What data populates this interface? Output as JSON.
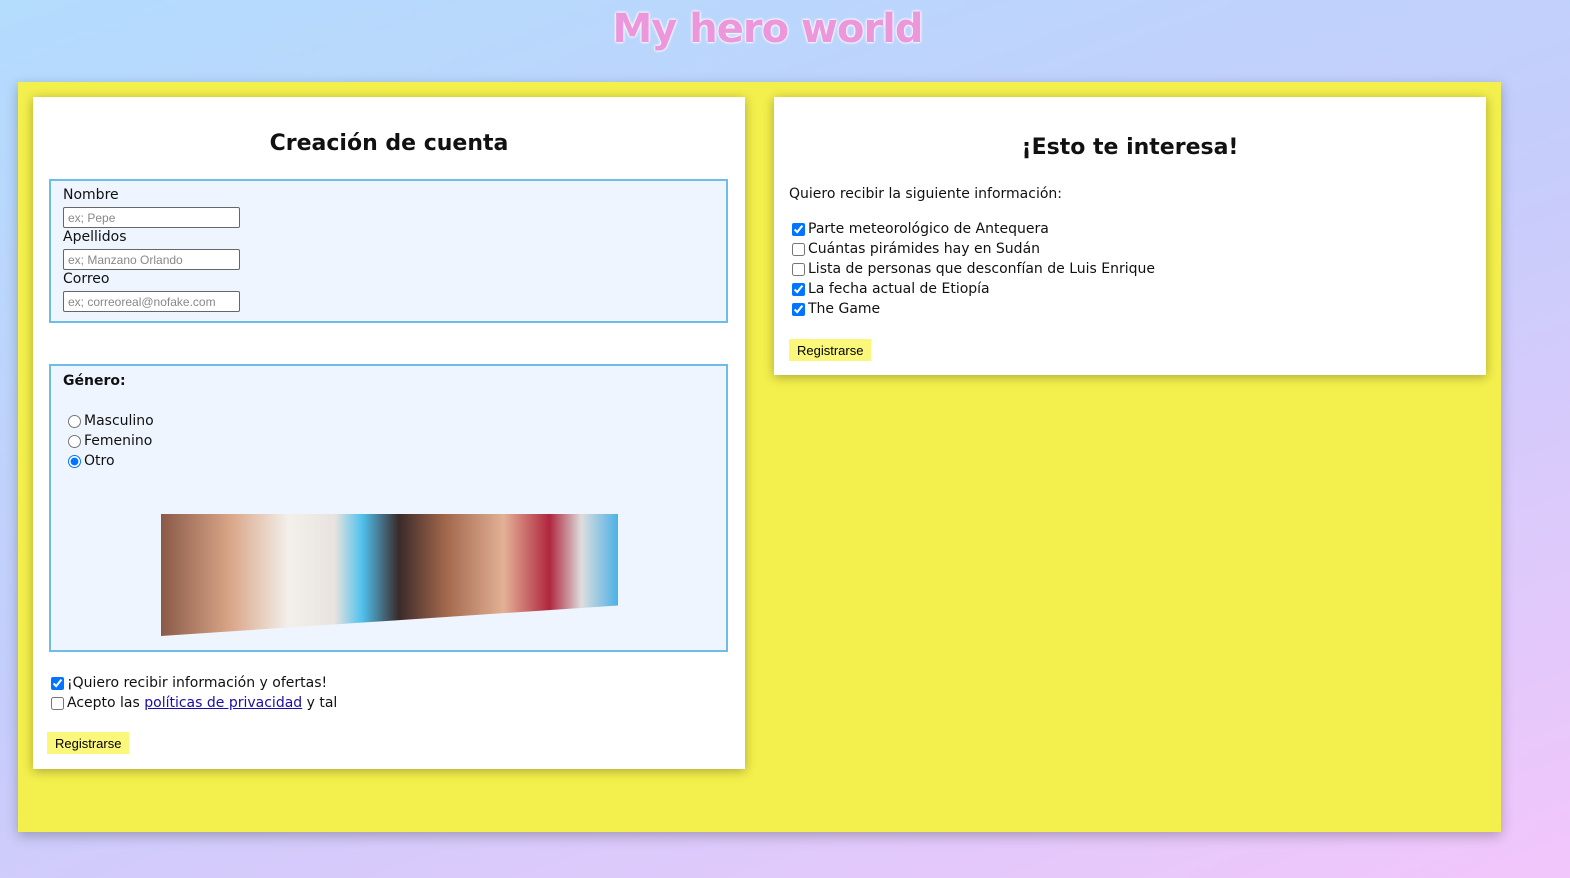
{
  "site_title": "My hero world",
  "account": {
    "title": "Creación de cuenta",
    "fields": [
      {
        "label": "Nombre",
        "placeholder": "ex; Pepe",
        "value": ""
      },
      {
        "label": "Apellidos",
        "placeholder": "ex; Manzano Orlando",
        "value": ""
      },
      {
        "label": "Correo",
        "placeholder": "ex; correoreal@nofake.com",
        "value": ""
      }
    ],
    "gender": {
      "label": "Género:",
      "options": [
        {
          "label": "Masculino",
          "checked": false
        },
        {
          "label": "Femenino",
          "checked": false
        },
        {
          "label": "Otro",
          "checked": true
        }
      ]
    },
    "offers": {
      "label": "¡Quiero recibir información y ofertas!",
      "checked": true
    },
    "privacy": {
      "prefix": "Acepto las ",
      "link": "políticas de privacidad",
      "suffix": " y tal",
      "checked": false
    },
    "submit": "Registrarse"
  },
  "interests": {
    "title": "¡Esto te interesa!",
    "intro": "Quiero recibir la siguiente información:",
    "items": [
      {
        "label": "Parte meteorológico de Antequera",
        "checked": true
      },
      {
        "label": "Cuántas pirámides hay en Sudán",
        "checked": false
      },
      {
        "label": "Lista de personas que desconfían de Luis Enrique",
        "checked": false
      },
      {
        "label": "La fecha actual de Etiopía",
        "checked": true
      },
      {
        "label": "The Game",
        "checked": true
      }
    ],
    "submit": "Registrarse"
  }
}
